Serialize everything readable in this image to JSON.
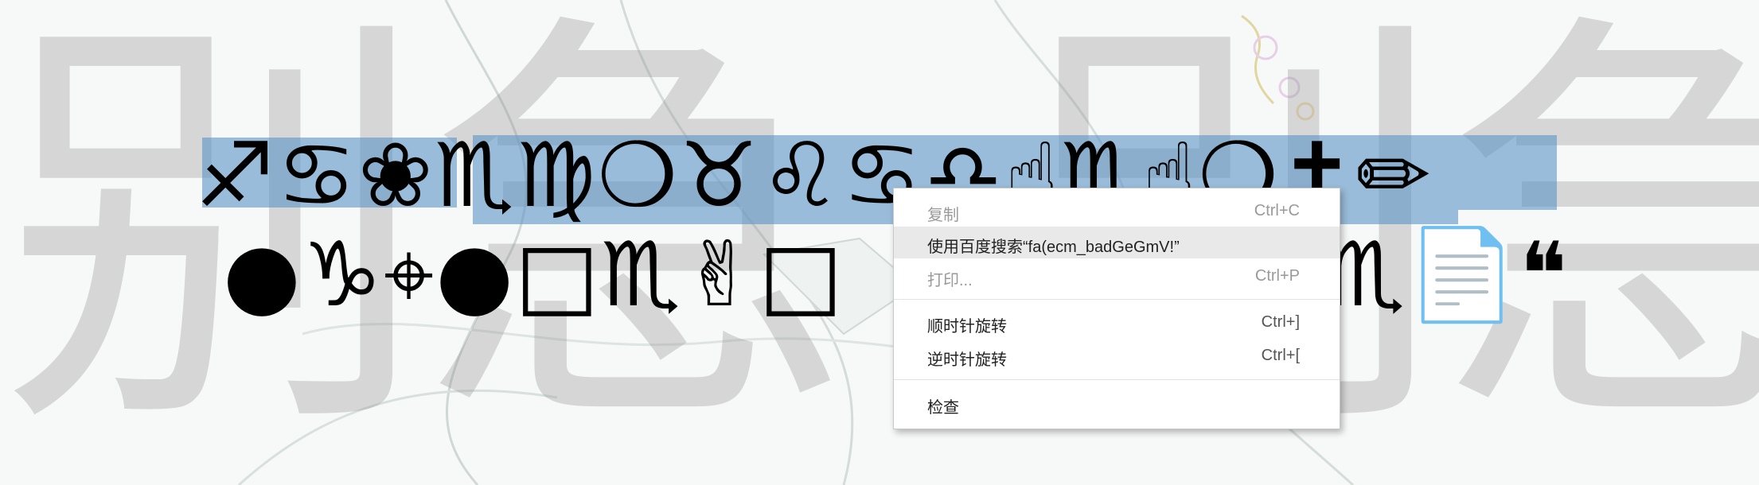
{
  "watermark": {
    "left": "别急",
    "right": "别急"
  },
  "glyphs": {
    "line1": "♐♋❀♏♍❍♉♌♋♎☝♏☝❍✝✏",
    "line2_left": "●♑⌖●□♏✌□",
    "line2_right": "♏📄❝"
  },
  "context_menu": {
    "copy": {
      "label": "复制",
      "shortcut": "Ctrl+C"
    },
    "search": {
      "label": "使用百度搜索“fa(ecm_badGeGmV!”"
    },
    "print": {
      "label": "打印...",
      "shortcut": "Ctrl+P"
    },
    "rotate_cw": {
      "label": "顺时针旋转",
      "shortcut": "Ctrl+]"
    },
    "rotate_ccw": {
      "label": "逆时针旋转",
      "shortcut": "Ctrl+["
    },
    "inspect": {
      "label": "检查"
    }
  },
  "colors": {
    "selection": "#6096c8",
    "watermark": "#969696",
    "menu_hover": "#e9e9e9"
  }
}
